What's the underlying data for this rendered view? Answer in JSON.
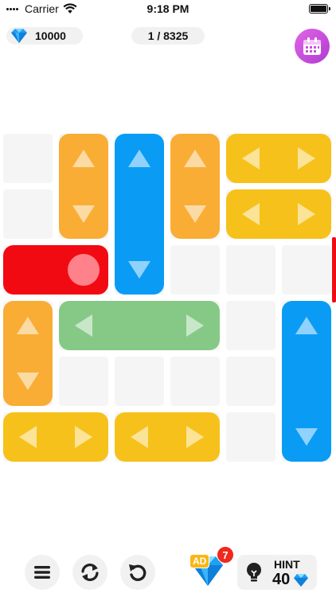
{
  "status_bar": {
    "carrier": "Carrier",
    "time": "9:18 PM"
  },
  "top_bar": {
    "gems": "10000",
    "level": "1 / 8325"
  },
  "toolbar": {
    "ad_label": "AD",
    "ad_badge_count": "7",
    "hint_label": "HINT",
    "hint_cost": "40"
  },
  "icons": {
    "wifi": "wifi-icon",
    "battery": "battery-icon",
    "gem": "diamond-icon",
    "calendar": "calendar-icon",
    "menu": "menu-icon",
    "shuffle": "shuffle-icon",
    "undo": "undo-icon",
    "hint": "lightbulb-icon"
  },
  "colors": {
    "orange": "#f9ad35",
    "yellow": "#f6c11a",
    "blue": "#0a9cf5",
    "green": "#86c987",
    "red": "#f20a13",
    "calendar": "#c94fdb"
  },
  "board": {
    "grid": {
      "rows": 6,
      "cols": 6
    },
    "blocks": [
      {
        "color": "orange",
        "row": 0,
        "col": 1,
        "length": 2,
        "orientation": "vertical"
      },
      {
        "color": "blue",
        "row": 0,
        "col": 2,
        "length": 3,
        "orientation": "vertical"
      },
      {
        "color": "orange",
        "row": 0,
        "col": 3,
        "length": 2,
        "orientation": "vertical"
      },
      {
        "color": "yellow",
        "row": 0,
        "col": 4,
        "length": 2,
        "orientation": "horizontal"
      },
      {
        "color": "yellow",
        "row": 1,
        "col": 4,
        "length": 2,
        "orientation": "horizontal"
      },
      {
        "color": "red",
        "row": 2,
        "col": 0,
        "length": 2,
        "orientation": "horizontal"
      },
      {
        "color": "orange",
        "row": 3,
        "col": 0,
        "length": 2,
        "orientation": "vertical"
      },
      {
        "color": "green",
        "row": 3,
        "col": 1,
        "length": 3,
        "orientation": "horizontal"
      },
      {
        "color": "blue",
        "row": 3,
        "col": 5,
        "length": 3,
        "orientation": "vertical"
      },
      {
        "color": "yellow",
        "row": 5,
        "col": 0,
        "length": 2,
        "orientation": "horizontal"
      },
      {
        "color": "yellow",
        "row": 5,
        "col": 2,
        "length": 2,
        "orientation": "horizontal"
      }
    ],
    "exit": {
      "side": "right",
      "row": 2
    }
  }
}
